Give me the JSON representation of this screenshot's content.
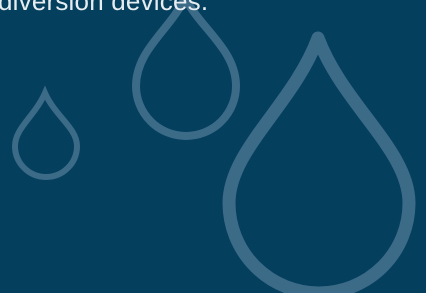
{
  "caption": {
    "text": "diversion devices."
  },
  "colors": {
    "background": "#053f5e",
    "caption_text": "#e6edf1",
    "drop_outline": "#3c6b88"
  },
  "icons": [
    "small-water-drop-icon",
    "medium-water-drop-icon",
    "large-water-drop-icon"
  ]
}
